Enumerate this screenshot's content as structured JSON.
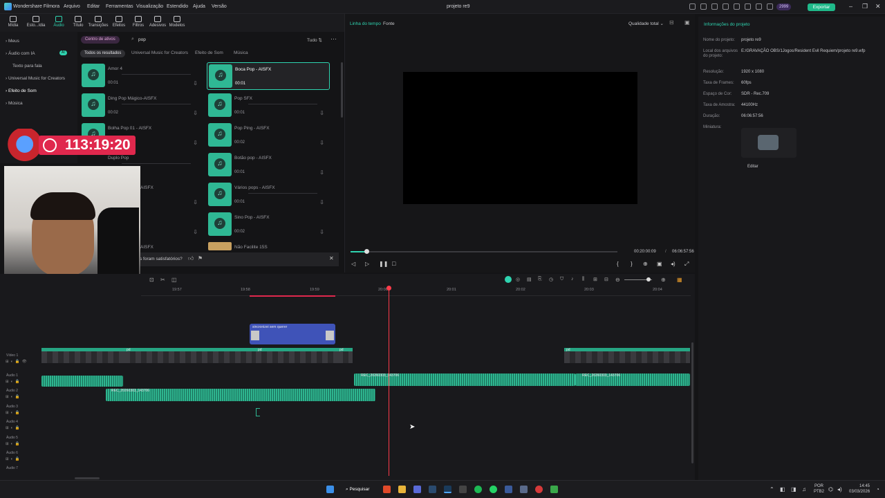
{
  "window": {
    "app_name": "Wondershare Filmora",
    "menu": [
      "Arquivo",
      "Editar",
      "Ferramentas",
      "Visualização",
      "Estendido",
      "Ajuda",
      "Versão"
    ],
    "project_title": "projeto re9",
    "credits": "2999",
    "export_label": "Exportar"
  },
  "toolbar": {
    "tools": [
      "Mídia",
      "Esto...ídia",
      "Áudio",
      "Título",
      "Transições",
      "Efeitos",
      "Filtros",
      "Adesivos",
      "Modelos"
    ],
    "active": "Áudio"
  },
  "leftnav": {
    "items": [
      "Meus",
      "Áudio com IA",
      "Texto para fala",
      "Universal Music for Creators",
      "Efeito de Som",
      "Música"
    ],
    "ai_badge": "AI"
  },
  "search": {
    "center_label": "Centro de ativos",
    "query": "pop",
    "filter_label": "Tudo"
  },
  "tabs": [
    "Todos os resultados",
    "Universal Music for Creators",
    "Efeito de Som",
    "Música"
  ],
  "assets": {
    "left": [
      {
        "name": "Amor 4",
        "duration": "00:01"
      },
      {
        "name": "Ding Pop Mágico-AISFX",
        "duration": "00:02"
      },
      {
        "name": "Bolha Pop 01 - AISFX",
        "duration": ""
      },
      {
        "name": "Duplo Pop",
        "duration": ""
      },
      {
        "name": "AISFX",
        "duration": ""
      },
      {
        "name": "",
        "duration": ""
      },
      {
        "name": "AISFX",
        "duration": ""
      }
    ],
    "right": [
      {
        "name": "Boca Pop - AISFX",
        "duration": "00:01"
      },
      {
        "name": "Pop SFX",
        "duration": "00:01"
      },
      {
        "name": "Pop Ping - AISFX",
        "duration": "00:02"
      },
      {
        "name": "Botão pop - AISFX",
        "duration": "00:01"
      },
      {
        "name": "Vários pops - AISFX",
        "duration": "00:01"
      },
      {
        "name": "Sino Pop - AISFX",
        "duration": "00:02"
      },
      {
        "name": "Não Facilite 15S",
        "duration": ""
      }
    ]
  },
  "feedback": {
    "question": "s foram satisfatórios?"
  },
  "overlay": {
    "timer": "113:19:20"
  },
  "preview": {
    "tab_timeline": "Linha do tempo",
    "tab_source": "Fonte",
    "quality": "Qualidade total",
    "current_time": "00:20:00:09",
    "separator": "/",
    "total_time": "06:06:57:56",
    "progress": 0.06
  },
  "project_info": {
    "header": "Informações do projeto",
    "fields": [
      {
        "key": "Nome do projeto:",
        "value": "projeto re9"
      },
      {
        "key": "Local dos arquivos do projeto:",
        "value": "E:/GRAVAÇÃO OBS/1Jogos/Resident Evil Requiem/projeto re9.wfp"
      },
      {
        "key": "Resolução:",
        "value": "1920 x 1080"
      },
      {
        "key": "Taxa de Frames:",
        "value": "60fps"
      },
      {
        "key": "Espaço de Cor:",
        "value": "SDR - Rec.709"
      },
      {
        "key": "Taxa de Amostra:",
        "value": "44100Hz"
      },
      {
        "key": "Duração:",
        "value": "06:06:57:56"
      },
      {
        "key": "Miniatura:",
        "value": ""
      }
    ],
    "edit_label": "Editar"
  },
  "timeline": {
    "ruler": [
      "19:57",
      "19:58",
      "19:59",
      "20:00",
      "20:01",
      "20:02",
      "20:03",
      "20:04"
    ],
    "tracks": [
      "Vídeo 1",
      "Áudio 1",
      "Áudio 2",
      "Áudio 3",
      "Áudio 4",
      "Áudio 5",
      "Áudio 6",
      "Áudio 7"
    ],
    "title_clip": "sincronizei sem querer",
    "video_clip_label": "pd",
    "audio_clip_label": "REC_20260303_143706"
  },
  "taskbar": {
    "search_label": "Pesquisar",
    "lang": "POR",
    "layout": "PTB2",
    "time": "14:45",
    "date": "03/03/2026"
  },
  "colors": {
    "accent": "#2fd4b0",
    "export": "#1fb98a",
    "playhead": "#ff3b4a",
    "timer_badge": "#e0284d",
    "title_clip": "#3f53b8"
  }
}
